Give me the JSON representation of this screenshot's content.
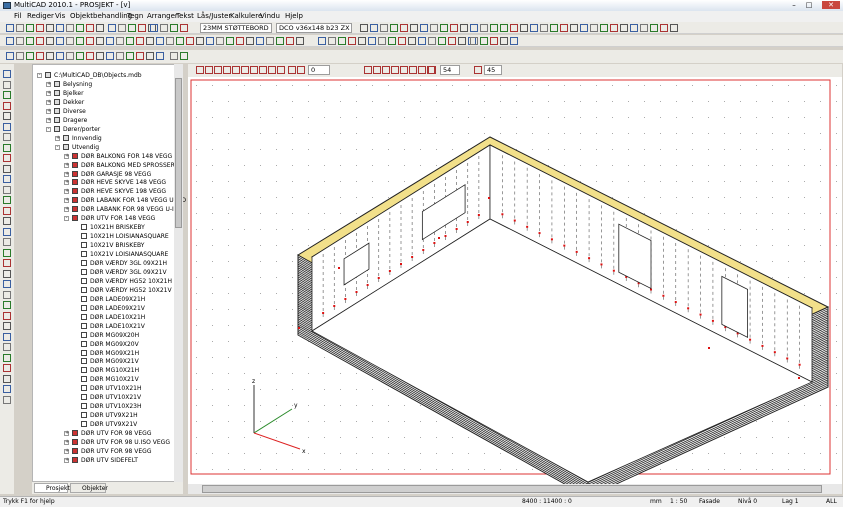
{
  "window": {
    "title": "MultiCAD 2010.1 - PROSJEKT - [v]"
  },
  "menu": [
    "Fil",
    "Rediger",
    "Vis",
    "Objektbehandling",
    "Tegn",
    "Arranger",
    "Tekst",
    "Lås/Juster",
    "Kalkulere",
    "Vindu",
    "Hjelp"
  ],
  "toolbar": {
    "layer_combo": "23MM STØTTEBORD",
    "object_combo": "DCO v36x148 b23 ZX"
  },
  "drawtb": {
    "field1": "0",
    "angle1": "54",
    "angle2": "45"
  },
  "tree": {
    "root": "C:\\MultiCAD_DB\\Objects.mdb",
    "items": [
      {
        "label": "Belysning",
        "lvl": 1,
        "exp": "+"
      },
      {
        "label": "Bjelker",
        "lvl": 1,
        "exp": "+"
      },
      {
        "label": "Dekker",
        "lvl": 1,
        "exp": "+"
      },
      {
        "label": "Diverse",
        "lvl": 1,
        "exp": "+"
      },
      {
        "label": "Dragere",
        "lvl": 1,
        "exp": "+"
      },
      {
        "label": "Dører/porter",
        "lvl": 1,
        "exp": "-"
      },
      {
        "label": "Innvendig",
        "lvl": 2,
        "exp": "+"
      },
      {
        "label": "Utvendig",
        "lvl": 2,
        "exp": "-"
      },
      {
        "label": "DØR BALKONG FOR 148 VEGG",
        "lvl": 3,
        "exp": "+"
      },
      {
        "label": "DØR BALKONG MED SPROSSER",
        "lvl": 3,
        "exp": "+"
      },
      {
        "label": "DØR GARASJE 98 VEGG",
        "lvl": 3,
        "exp": "+"
      },
      {
        "label": "DØR HEVE SKYVE 148 VEGG",
        "lvl": 3,
        "exp": "+"
      },
      {
        "label": "DØR HEVE SKYVE 198 VEGG",
        "lvl": 3,
        "exp": "+"
      },
      {
        "label": "DØR LABANK FOR 148 VEGG U-ISO",
        "lvl": 3,
        "exp": "+"
      },
      {
        "label": "DØR LABANK FOR 98 VEGG U-ISO",
        "lvl": 3,
        "exp": "+"
      },
      {
        "label": "DØR UTV FOR 148 VEGG",
        "lvl": 3,
        "exp": "-"
      },
      {
        "label": "10X21H BRISKEBY",
        "lvl": 4
      },
      {
        "label": "10X21H LOISIANASQUARE",
        "lvl": 4
      },
      {
        "label": "10X21V BRISKEBY",
        "lvl": 4
      },
      {
        "label": "10X21V LOISIANASQUARE",
        "lvl": 4
      },
      {
        "label": "DØR  VÆRDY 3GL 09X21H",
        "lvl": 4
      },
      {
        "label": "DØR  VÆRDY 3GL 09X21V",
        "lvl": 4
      },
      {
        "label": "DØR  VÆRDY HG52 10X21H",
        "lvl": 4
      },
      {
        "label": "DØR  VÆRDY HG52 10X21V",
        "lvl": 4
      },
      {
        "label": "DØR LADE09X21H",
        "lvl": 4
      },
      {
        "label": "DØR LADE09X21V",
        "lvl": 4
      },
      {
        "label": "DØR LADE10X21H",
        "lvl": 4
      },
      {
        "label": "DØR LADE10X21V",
        "lvl": 4
      },
      {
        "label": "DØR MG09X20H",
        "lvl": 4
      },
      {
        "label": "DØR MG09X20V",
        "lvl": 4
      },
      {
        "label": "DØR MG09X21H",
        "lvl": 4
      },
      {
        "label": "DØR MG09X21V",
        "lvl": 4
      },
      {
        "label": "DØR MG10X21H",
        "lvl": 4
      },
      {
        "label": "DØR MG10X21V",
        "lvl": 4
      },
      {
        "label": "DØR UTV10X21H",
        "lvl": 4
      },
      {
        "label": "DØR UTV10X21V",
        "lvl": 4
      },
      {
        "label": "DØR UTV10X23H",
        "lvl": 4
      },
      {
        "label": "DØR UTV9X21H",
        "lvl": 4
      },
      {
        "label": "DØR UTV9X21V",
        "lvl": 4
      },
      {
        "label": "DØR UTV FOR 98 VEGG",
        "lvl": 3,
        "exp": "+"
      },
      {
        "label": "DØR UTV FOR 98 U.ISO VEGG",
        "lvl": 3,
        "exp": "+"
      },
      {
        "label": "DØR UTV FOR 98 VEGG",
        "lvl": 3,
        "exp": "+"
      },
      {
        "label": "DØR UTV SIDEFELT",
        "lvl": 3,
        "exp": "+"
      }
    ]
  },
  "tabs": [
    "Prosjekt",
    "Objekter"
  ],
  "status": {
    "hint": "Trykk F1 for hjelp",
    "coords": "8400 : 11400 : 0",
    "unit": "mm",
    "scale": "1 : 50",
    "view": "Fasade",
    "level": "Nivå 0",
    "layer": "Lag 1",
    "filter": "ALL"
  },
  "axes": {
    "x": "x",
    "y": "y",
    "z": "z"
  },
  "colors": {
    "accent": "#d11",
    "wall": "#222",
    "cap": "#f2e08a"
  }
}
